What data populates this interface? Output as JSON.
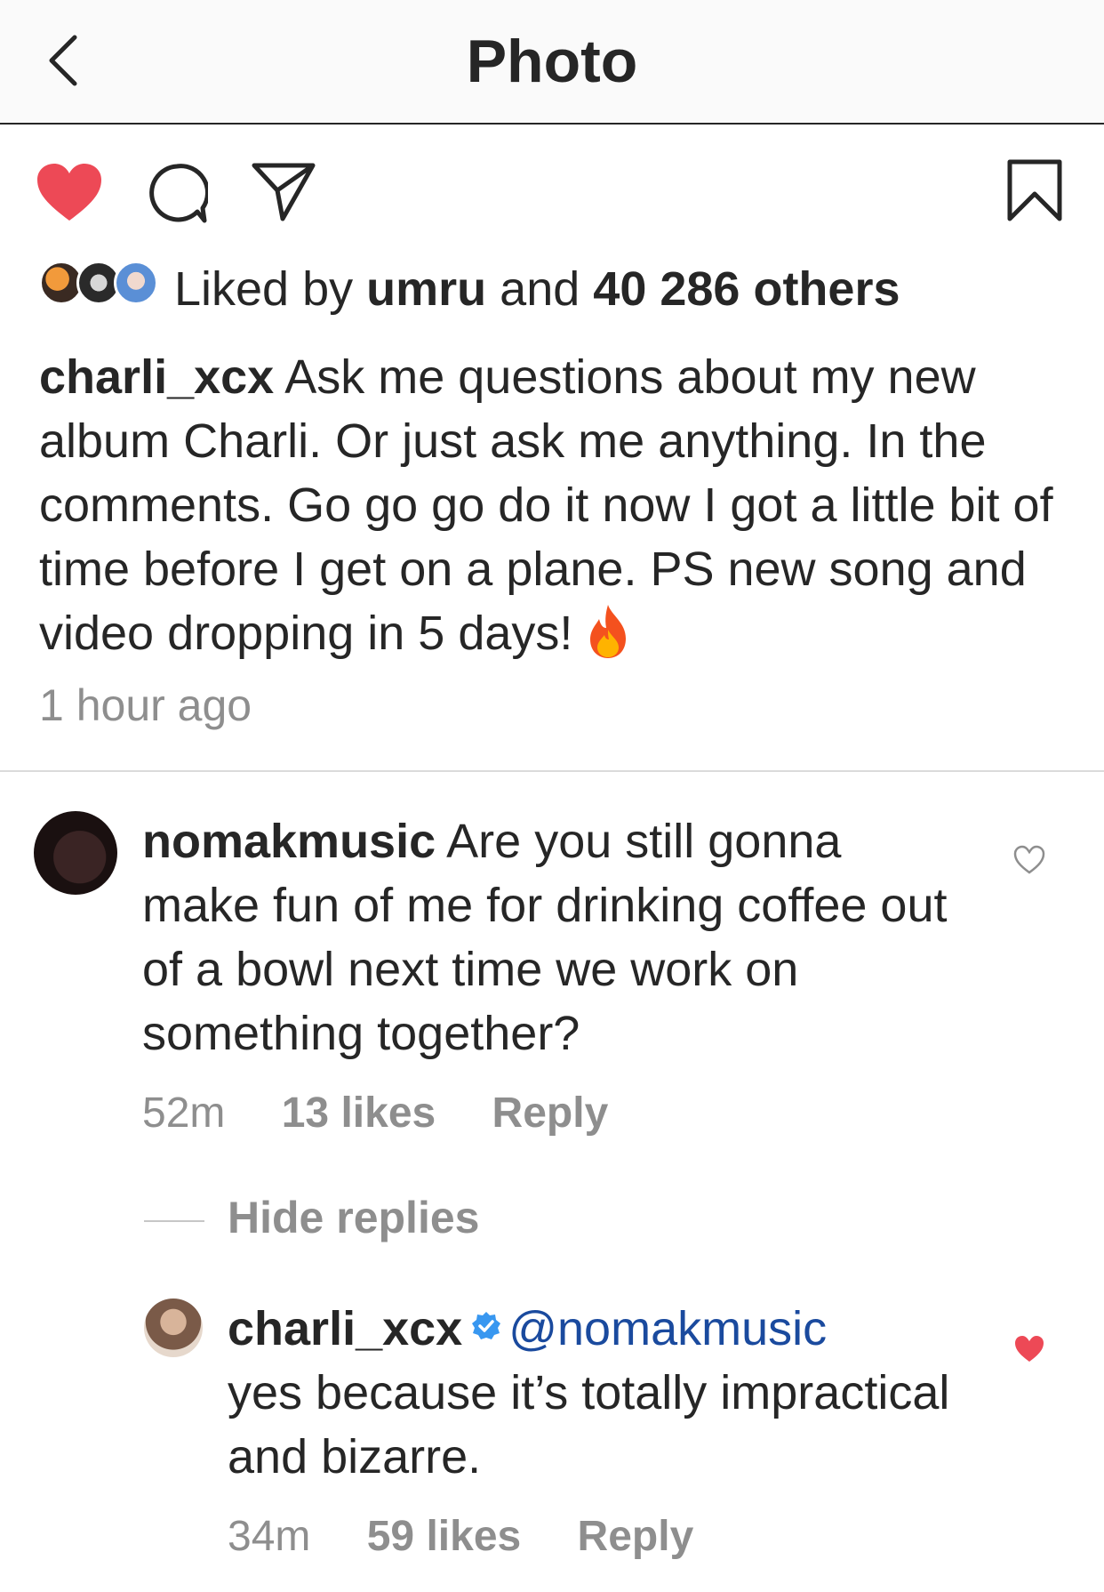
{
  "navbar": {
    "title": "Photo"
  },
  "likes": {
    "prefix": "Liked by",
    "user": "umru",
    "conj": "and",
    "others": "40 286 others"
  },
  "post": {
    "author": "charli_xcx",
    "caption": "Ask me questions about my new album Charli. Or just ask me anything. In the comments. Go go go do it now I got a little bit of time before I get on a plane. PS new song and video dropping in 5 days!",
    "timestamp": "1 hour ago"
  },
  "comments": [
    {
      "user": "nomakmusic",
      "text": "Are you still gonna make fun of me for drinking coffee out of a bowl next time we work on something together?",
      "time": "52m",
      "likes": "13 likes",
      "reply": "Reply",
      "liked": false
    }
  ],
  "hide_replies": "Hide replies",
  "reply": {
    "user": "charli_xcx",
    "mention": "@nomakmusic",
    "text": "yes because it’s totally impractical and bizarre.",
    "time": "34m",
    "likes": "59 likes",
    "reply": "Reply",
    "liked": true
  },
  "colors": {
    "like_red": "#ed4956",
    "text": "#262626",
    "muted": "#8e8e8e",
    "mention": "#1a4a9e",
    "verified": "#3897f0"
  },
  "icons": [
    "back-chevron-icon",
    "heart-filled-icon",
    "comment-icon",
    "share-icon",
    "bookmark-icon",
    "fire-emoji-icon",
    "verified-badge-icon",
    "heart-outline-icon"
  ]
}
